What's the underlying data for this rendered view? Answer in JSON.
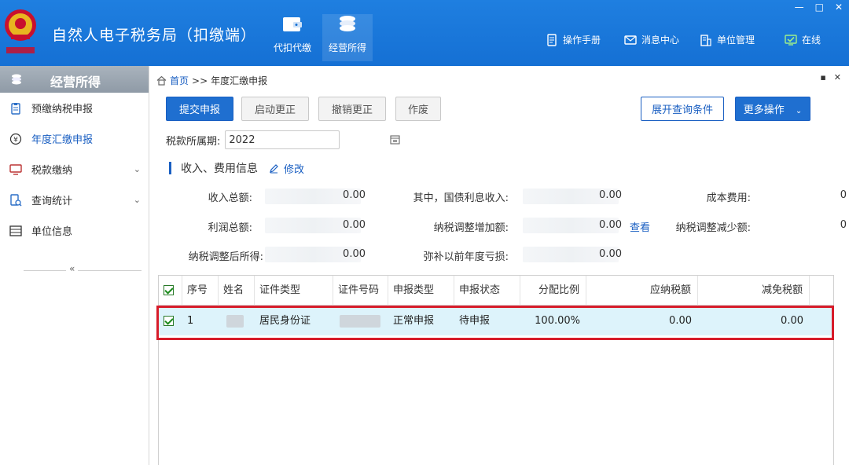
{
  "app": {
    "title": "自然人电子税务局（扣缴端）",
    "modules": [
      {
        "label": "代扣代缴",
        "icon": "wallet-icon"
      },
      {
        "label": "经营所得",
        "icon": "coins-icon"
      }
    ],
    "header_links": [
      {
        "label": "操作手册",
        "icon": "manual-icon"
      },
      {
        "label": "消息中心",
        "icon": "mail-icon"
      },
      {
        "label": "单位管理",
        "icon": "building-icon"
      },
      {
        "label": "在线",
        "icon": "online-status-icon"
      }
    ],
    "colors": {
      "header": "#1570d4",
      "accent": "#1a5fc2",
      "highlight_border": "#d71c2a",
      "row_selected": "#ddf3fb"
    }
  },
  "sidebar": {
    "header": "经营所得",
    "items": [
      {
        "label": "预缴纳税申报",
        "icon": "clipboard-icon"
      },
      {
        "label": "年度汇缴申报",
        "icon": "yen-icon"
      },
      {
        "label": "税款缴纳",
        "icon": "monitor-icon"
      },
      {
        "label": "查询统计",
        "icon": "search-doc-icon"
      },
      {
        "label": "单位信息",
        "icon": "list-icon"
      }
    ],
    "collapse_glyph": "«"
  },
  "breadcrumb": {
    "home": "首页",
    "sep": ">>",
    "current": "年度汇缴申报"
  },
  "toolbar": {
    "submit": "提交申报",
    "start_correction": "启动更正",
    "cancel_correction": "撤销更正",
    "void": "作废",
    "expand_query": "展开查询条件",
    "more": "更多操作"
  },
  "period": {
    "label": "税款所属期:",
    "value": "2022"
  },
  "income_section": {
    "title": "收入、费用信息",
    "edit": "修改",
    "view": "查看",
    "fields": [
      {
        "label": "收入总额:",
        "value": "0.00"
      },
      {
        "label": "其中，国债利息收入:",
        "value": "0.00"
      },
      {
        "label": "成本费用:",
        "value": "0"
      },
      {
        "label": "利润总额:",
        "value": "0.00"
      },
      {
        "label": "纳税调整增加额:",
        "value": "0.00"
      },
      {
        "label": "纳税调整减少额:",
        "value": "0"
      },
      {
        "label": "纳税调整后所得:",
        "value": "0.00"
      },
      {
        "label": "弥补以前年度亏损:",
        "value": "0.00"
      }
    ]
  },
  "table": {
    "columns": [
      "序号",
      "姓名",
      "证件类型",
      "证件号码",
      "申报类型",
      "申报状态",
      "分配比例",
      "应纳税额",
      "减免税额"
    ],
    "rows": [
      {
        "seq": "1",
        "name": "",
        "id_type": "居民身份证",
        "id_no": "",
        "report_type": "正常申报",
        "status": "待申报",
        "ratio": "100.00%",
        "tax_payable": "0.00",
        "tax_relief": "0.00",
        "checked": true
      }
    ]
  }
}
